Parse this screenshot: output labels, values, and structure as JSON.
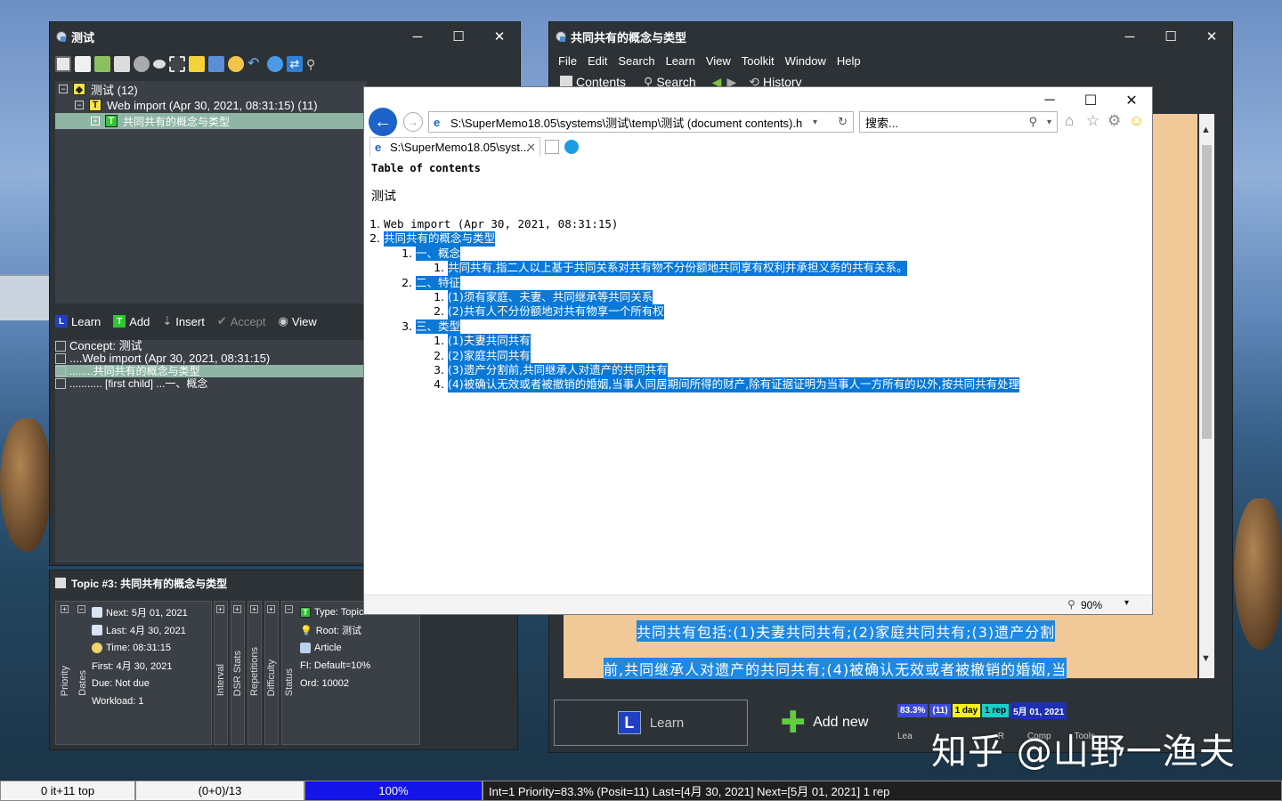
{
  "left_window": {
    "title": "测试",
    "tree": [
      {
        "label": "测试 (12)",
        "expander": "−"
      },
      {
        "label": "Web import (Apr 30, 2021, 08:31:15) (11)",
        "expander": "−"
      },
      {
        "label": "共同共有的概念与类型",
        "expander": "+"
      }
    ],
    "actions": {
      "learn": "Learn",
      "add": "Add",
      "insert": "Insert",
      "accept": "Accept",
      "view": "View"
    },
    "registry": [
      "Concept: 测试",
      "....Web import (Apr 30, 2021, 08:31:15)",
      "........共同共有的概念与类型",
      "........... [first child] ...一、概念"
    ]
  },
  "element_window": {
    "title": "Topic #3: 共同共有的概念与类型",
    "dates": {
      "next": "Next: 5月 01, 2021",
      "last": "Last: 4月 30, 2021",
      "time": "Time: 08:31:15",
      "first": "First: 4月 30, 2021",
      "due": "Due: Not due",
      "workload": "Workload: 1"
    },
    "labels": {
      "priority": "Priority",
      "dates": "Dates",
      "interval": "Interval",
      "dsr": "DSR Stats",
      "repetitions": "Repetitions",
      "difficulty": "Difficulty",
      "status": "Status"
    },
    "status": {
      "type": "Type: Topic",
      "root": "Root: 测试",
      "article": "Article",
      "fi": "FI: Default=10%",
      "ord": "Ord: 10002"
    }
  },
  "right_window": {
    "title": "共同共有的概念与类型",
    "menu": [
      "File",
      "Edit",
      "Search",
      "Learn",
      "View",
      "Toolkit",
      "Window",
      "Help"
    ],
    "toolbar": {
      "contents": "Contents",
      "search": "Search",
      "history": "History"
    },
    "content_lines": [
      "共同共有包括:(1)夫妻共同共有;(2)家庭共同共有;(3)遗产分割",
      "前,共同继承人对遗产的共同共有;(4)被确认无效或者被撤销的婚姻,当"
    ],
    "learn_label": "Learn",
    "add_new_label": "Add new",
    "status_chips": {
      "pct": "83.3%",
      "count": "(11)",
      "day": "1 day",
      "rep": "1 rep",
      "date": "5月 01, 2021"
    },
    "sub_labels": {
      "learn": "Lea",
      "tools": "Tools",
      "comp": "Comp",
      "r": "R"
    }
  },
  "browser": {
    "address": "S:\\SuperMemo18.05\\systems\\测试\\temp\\测试 (document contents).h",
    "search_placeholder": "搜索...",
    "tab_label": "S:\\SuperMemo18.05\\syst...",
    "zoom": "90%",
    "doc": {
      "toc_title": "Table of contents",
      "root": "测试",
      "items": [
        {
          "level": 1,
          "num": "1.",
          "text": "Web import (Apr 30, 2021, 08:31:15)",
          "hl": false
        },
        {
          "level": 1,
          "num": "2.",
          "text": "共同共有的概念与类型",
          "hl": true
        },
        {
          "level": 2,
          "num": "1.",
          "text": "一、概念",
          "hl": true
        },
        {
          "level": 3,
          "num": "1.",
          "text": "共同共有,指二人以上基于共同关系对共有物不分份额地共同享有权利并承担义务的共有关系。",
          "hl": true
        },
        {
          "level": 2,
          "num": "2.",
          "text": "二、特征",
          "hl": true
        },
        {
          "level": 3,
          "num": "1.",
          "text": "(1)须有家庭、夫妻、共同继承等共同关系",
          "hl": true
        },
        {
          "level": 3,
          "num": "2.",
          "text": "(2)共有人不分份额地对共有物享一个所有权",
          "hl": true
        },
        {
          "level": 2,
          "num": "3.",
          "text": "三、类型",
          "hl": true
        },
        {
          "level": 3,
          "num": "1.",
          "text": "(1)夫妻共同共有",
          "hl": true
        },
        {
          "level": 3,
          "num": "2.",
          "text": "(2)家庭共同共有",
          "hl": true
        },
        {
          "level": 3,
          "num": "3.",
          "text": "(3)遗产分割前,共同继承人对遗产的共同共有",
          "hl": true
        },
        {
          "level": 3,
          "num": "4.",
          "text": "(4)被确认无效或者被撤销的婚姻,当事人同居期间所得的财产,除有证据证明为当事人一方所有的以外,按共同共有处理",
          "hl": true
        }
      ]
    }
  },
  "taskbar": {
    "c1": "0 it+11 top",
    "c2": "(0+0)/13",
    "progress": "100%",
    "info": "Int=1 Priority=83.3% (Posit=11) Last=[4月 30, 2021] Next=[5月 01, 2021] 1 rep"
  },
  "watermark": "知乎 @山野一渔夫",
  "colors": {
    "accent": "#0a78d7",
    "highlight_green": "#2fc62f",
    "topic_yellow": "#ffe14a",
    "content_bg": "#f1c897"
  }
}
